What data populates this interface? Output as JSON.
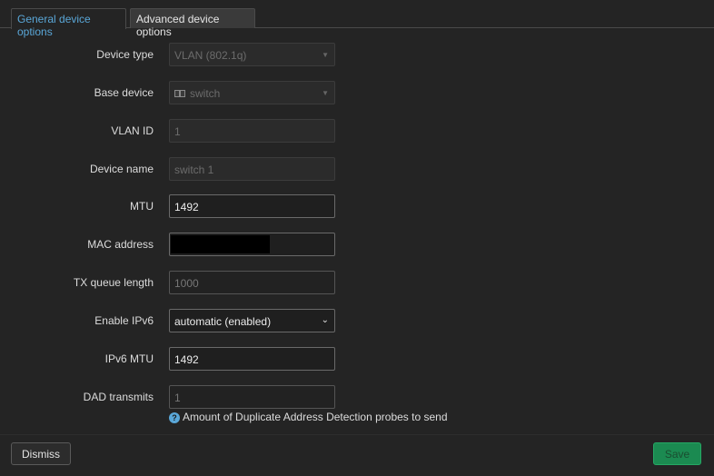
{
  "tabs": [
    {
      "label": "General device options",
      "active": true
    },
    {
      "label": "Advanced device options",
      "active": false
    }
  ],
  "form": {
    "device_type": {
      "label": "Device type",
      "value": "VLAN (802.1q)"
    },
    "base_device": {
      "label": "Base device",
      "value": "switch",
      "icon": "switch-icon"
    },
    "vlan_id": {
      "label": "VLAN ID",
      "placeholder": "1"
    },
    "device_name": {
      "label": "Device name",
      "placeholder": "switch 1"
    },
    "mtu": {
      "label": "MTU",
      "value": "1492"
    },
    "mac_address": {
      "label": "MAC address",
      "value": ""
    },
    "tx_queue_length": {
      "label": "TX queue length",
      "placeholder": "1000"
    },
    "enable_ipv6": {
      "label": "Enable IPv6",
      "value": "automatic (enabled)"
    },
    "ipv6_mtu": {
      "label": "IPv6 MTU",
      "value": "1492"
    },
    "dad_transmits": {
      "label": "DAD transmits",
      "placeholder": "1",
      "hint": "Amount of Duplicate Address Detection probes to send"
    }
  },
  "buttons": {
    "dismiss": "Dismiss",
    "save": "Save"
  },
  "colors": {
    "background": "#242424",
    "accent": "#5aa7d8",
    "save_button": "#1b8a51"
  }
}
